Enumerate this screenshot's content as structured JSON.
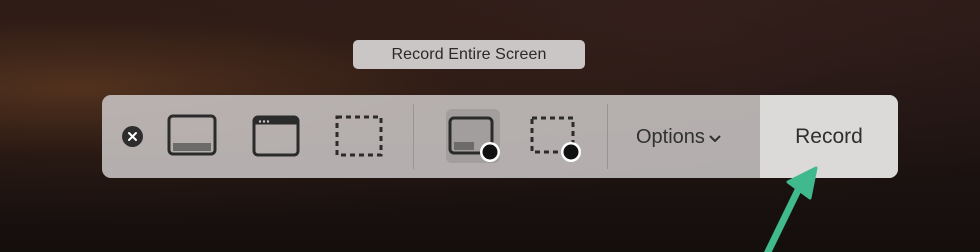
{
  "tooltip": {
    "text": "Record Entire Screen"
  },
  "toolbar": {
    "close_icon": "close-x-icon",
    "buttons": [
      {
        "id": "capture-entire-screen",
        "icon": "screen-capture-icon",
        "selected": false
      },
      {
        "id": "capture-selected-window",
        "icon": "window-capture-icon",
        "selected": false
      },
      {
        "id": "capture-selected-portion",
        "icon": "selection-capture-icon",
        "selected": false
      },
      {
        "id": "record-entire-screen",
        "icon": "screen-record-icon",
        "selected": true
      },
      {
        "id": "record-selected-portion",
        "icon": "selection-record-icon",
        "selected": false
      }
    ],
    "options_label": "Options",
    "options_icon": "chevron-down-icon",
    "record_label": "Record"
  },
  "annotation": {
    "icon": "arrow-icon",
    "color": "#3fb98d"
  },
  "colors": {
    "toolbar_background": "#c8c4c4",
    "selected_button": "#969292",
    "tooltip_background": "#d6d3d3"
  }
}
